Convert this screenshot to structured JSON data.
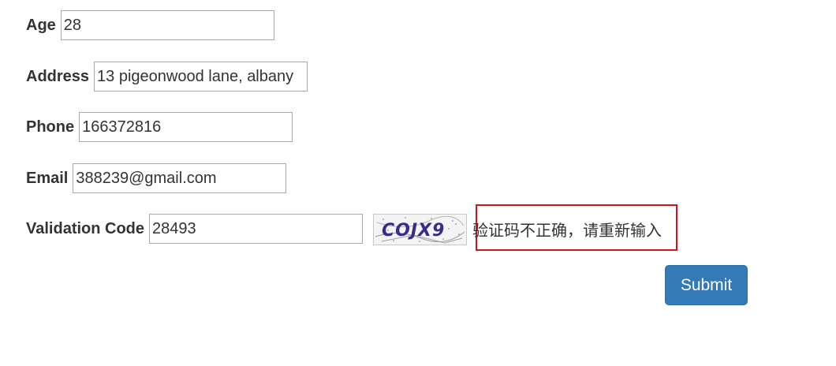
{
  "form": {
    "age": {
      "label": "Age",
      "value": "28"
    },
    "address": {
      "label": "Address",
      "value": "13 pigeonwood lane, albany"
    },
    "phone": {
      "label": "Phone",
      "value": "166372816"
    },
    "email": {
      "label": "Email",
      "value": "388239@gmail.com"
    },
    "validation": {
      "label": "Validation Code",
      "value": "28493"
    },
    "captcha": {
      "text": "COJX9",
      "color": "#3a2a8c"
    },
    "error_message": "验证码不正确，请重新输入",
    "submit_label": "Submit"
  },
  "colors": {
    "primary_button": "#337ab7",
    "error_border": "#d0141a"
  }
}
